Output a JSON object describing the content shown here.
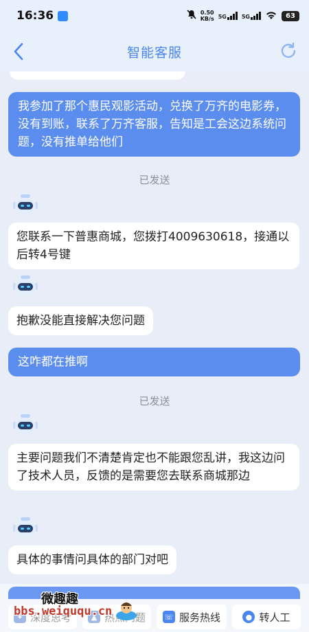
{
  "status_bar": {
    "time": "16:36",
    "net_speed_value": "0.50",
    "net_speed_unit": "KB/s",
    "sim1": "5G",
    "sim2": "5G",
    "battery": "63"
  },
  "nav": {
    "title": "智能客服"
  },
  "messages": [
    {
      "from": "user",
      "text": "我参加了那个惠民观影活动，兑换了万齐的电影券，没有到账，联系了万齐客服，告知是工会这边系统问题，没有推单给他们"
    },
    {
      "status": "已发送"
    },
    {
      "from": "bot",
      "text": "您联系一下普惠商城，您拨打4009630618，接通以后转4号键"
    },
    {
      "from": "bot",
      "text": "抱歉没能直接解决您问题"
    },
    {
      "from": "user",
      "text": "这咋都在推啊"
    },
    {
      "status": "已发送"
    },
    {
      "from": "bot",
      "text": "主要问题我们不清楚肯定也不能跟您乱讲，我这边问了技术人员，反馈的是需要您去联系商城那边"
    },
    {
      "from": "bot",
      "text": "具体的事情问具体的部门对吧"
    }
  ],
  "quick_actions": {
    "a1": "深度思考",
    "a2": "热点问题",
    "a3": "服务热线",
    "a4": "转人工"
  },
  "watermark": {
    "line1": "微趣趣",
    "line2": "bbs.weiququ.cn"
  },
  "colors": {
    "accent": "#5b8def",
    "nav_title": "#4a86ef",
    "background": "#e8edf7"
  }
}
